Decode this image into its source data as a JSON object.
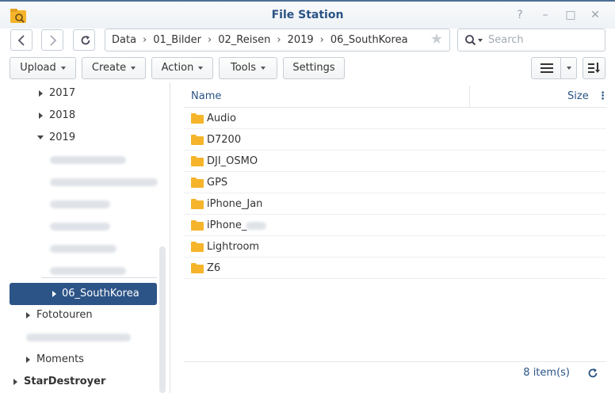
{
  "window": {
    "title": "File Station",
    "controls": [
      "?",
      "–",
      "□",
      "✕"
    ]
  },
  "nav": {
    "breadcrumb": [
      "Data",
      "01_Bilder",
      "02_Reisen",
      "2019",
      "06_SouthKorea"
    ],
    "search_placeholder": "Search"
  },
  "toolbar": {
    "upload": "Upload",
    "create": "Create",
    "action": "Action",
    "tools": "Tools",
    "settings": "Settings"
  },
  "sidebar": {
    "year_2017": "2017",
    "year_2018": "2018",
    "year_2019": "2019",
    "selected": "06_SouthKorea",
    "fototouren": "Fototouren",
    "moments": "Moments",
    "stardestroyer": "StarDestroyer"
  },
  "list": {
    "col_name": "Name",
    "col_size": "Size",
    "rows": [
      "Audio",
      "D7200",
      "DJI_OSMO",
      "GPS",
      "iPhone_Jan",
      "iPhone_",
      "Lightroom",
      "Z6"
    ],
    "count": "8 item(s)"
  },
  "colors": {
    "accent": "#2c5487",
    "folder": "#f5b42a",
    "title_text": "#2a5384"
  }
}
